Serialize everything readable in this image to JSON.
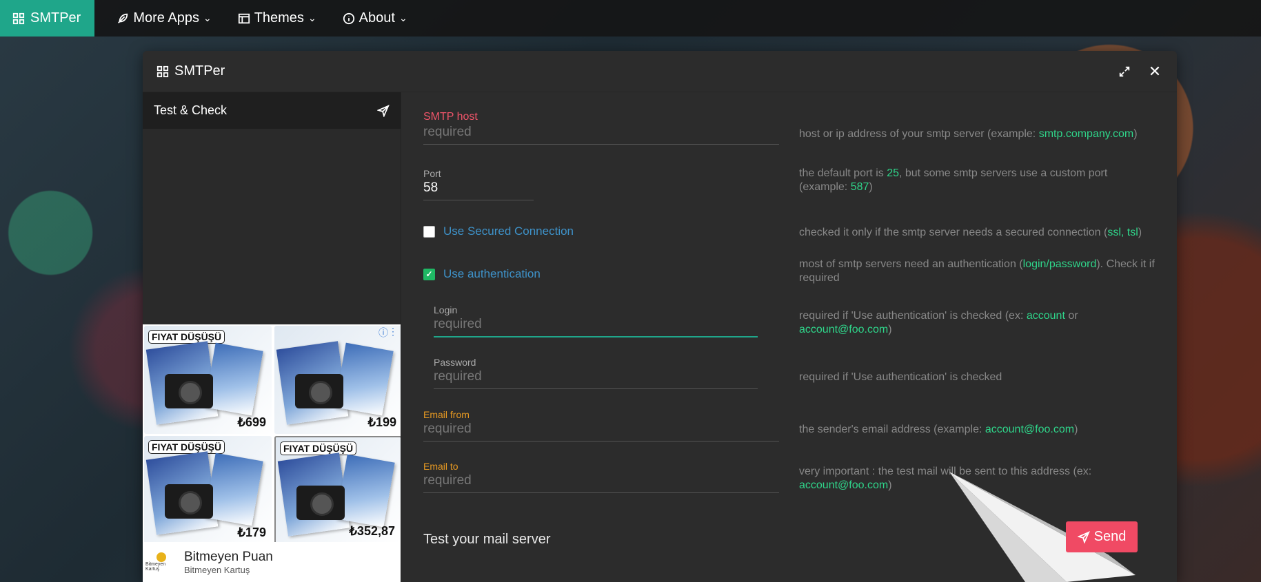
{
  "navbar": {
    "brand": "SMTPer",
    "more_apps": "More Apps",
    "themes": "Themes",
    "about": "About"
  },
  "window": {
    "title": "SMTPer",
    "sidebar_item": "Test & Check"
  },
  "ad": {
    "badge": "FIYAT DÜŞÜŞÜ",
    "prices": [
      "₺699",
      "₺199",
      "₺179",
      "₺352,87"
    ],
    "brand_name": "Bitmeyen Puan",
    "brand_sub": "Bitmeyen Kartuş",
    "logo_text": "Bitmeyen Kartuş"
  },
  "form": {
    "smtp_host": {
      "label": "SMTP host",
      "placeholder": "required",
      "hint_pre": "host or ip address of your smtp server (example: ",
      "hint_hl": "smtp.company.com",
      "hint_post": ")"
    },
    "port": {
      "label": "Port",
      "value": "58",
      "hint_pre": "the default port is ",
      "hint_hl1": "25",
      "hint_mid": ", but some smtp servers use a custom port (example: ",
      "hint_hl2": "587",
      "hint_post": ")"
    },
    "secured": {
      "label": "Use Secured Connection",
      "checked": false,
      "hint_pre": "checked it only if the smtp server needs a secured connection (",
      "hint_hl": "ssl, tsl",
      "hint_post": ")"
    },
    "auth": {
      "label": "Use authentication",
      "checked": true,
      "hint_pre": "most of smtp servers need an authentication (",
      "hint_hl": "login/password",
      "hint_post": "). Check it if required"
    },
    "login": {
      "label": "Login",
      "placeholder": "required",
      "hint_pre": "required if 'Use authentication' is checked (ex: ",
      "hint_hl1": "account",
      "hint_mid": " or ",
      "hint_hl2": "account@foo.com",
      "hint_post": ")"
    },
    "password": {
      "label": "Password",
      "placeholder": "required",
      "hint": "required if 'Use authentication' is checked"
    },
    "email_from": {
      "label": "Email from",
      "placeholder": "required",
      "hint_pre": "the sender's email address (example: ",
      "hint_hl": "account@foo.com",
      "hint_post": ")"
    },
    "email_to": {
      "label": "Email to",
      "placeholder": "required",
      "hint_pre": "very important : the test mail will be sent to this address (ex: ",
      "hint_hl": "account@foo.com",
      "hint_post": ")"
    }
  },
  "test_section": {
    "title": "Test your mail server",
    "send_label": "Send"
  },
  "colors": {
    "brand": "#1fa68a",
    "send": "#f04a64",
    "link": "#3e92c9",
    "hint_highlight": "#2fd58a"
  }
}
